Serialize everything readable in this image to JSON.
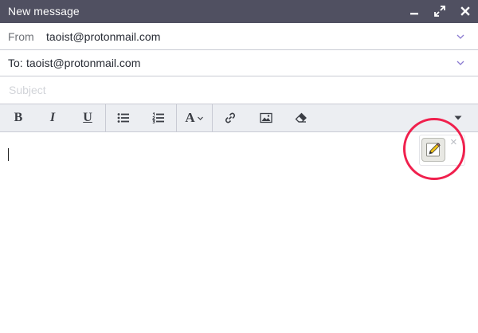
{
  "window": {
    "title": "New message",
    "controls": {
      "minimize": "minimize-icon",
      "maximize": "maximize-icon",
      "close": "close-icon"
    }
  },
  "from": {
    "label": "From",
    "value": "taoist@protonmail.com"
  },
  "to": {
    "label": "To:",
    "value": "taoist@protonmail.com"
  },
  "subject": {
    "placeholder": "Subject",
    "value": ""
  },
  "toolbar": {
    "items": [
      "bold",
      "italic",
      "underline",
      "bulleted-list",
      "numbered-list",
      "font",
      "link",
      "image",
      "clear-formatting",
      "more"
    ],
    "bold_glyph": "B",
    "italic_glyph": "I",
    "underline_glyph": "U",
    "font_glyph": "A"
  },
  "snippet_popup": {
    "icon": "pencil-notepad-icon",
    "close_glyph": "×"
  },
  "colors": {
    "titlebar": "#505061",
    "toolbar": "#eceef2",
    "chevron": "#8a7ad0",
    "highlight": "#f0204d"
  }
}
